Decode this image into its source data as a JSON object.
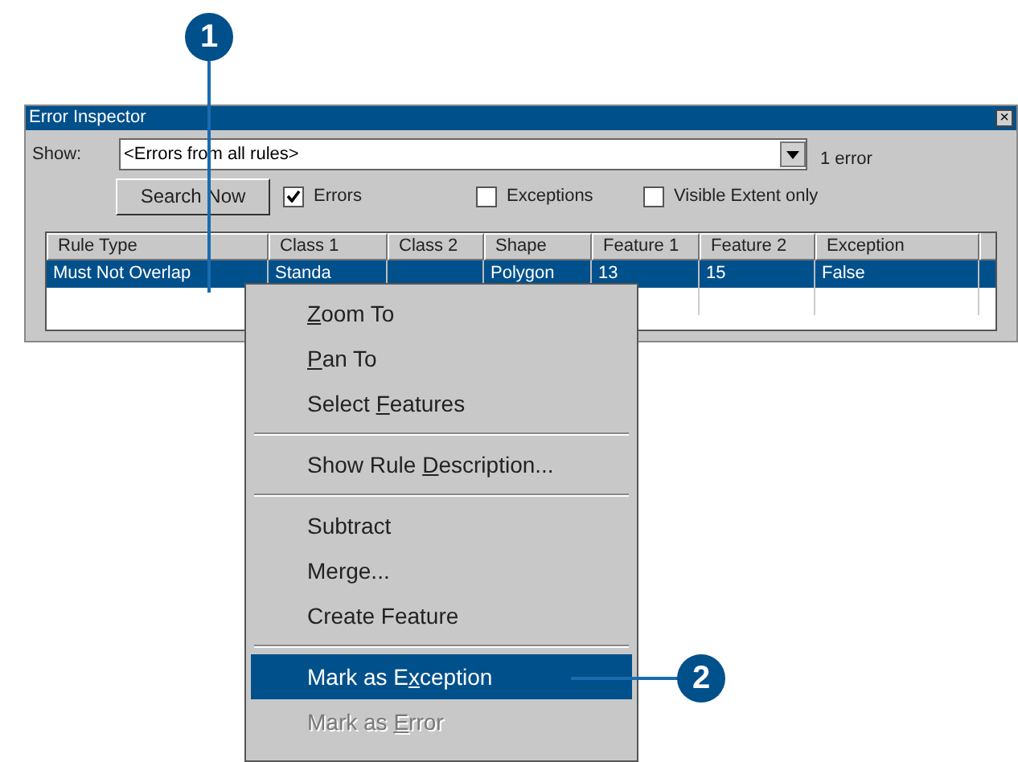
{
  "callouts": [
    {
      "number": "1"
    },
    {
      "number": "2"
    }
  ],
  "window": {
    "title": "Error Inspector",
    "close": "×"
  },
  "show": {
    "label": "Show:",
    "value": "<Errors from all rules>",
    "count": "1 error"
  },
  "search_button": "Search Now",
  "checkboxes": [
    {
      "label": "Errors",
      "checked": true
    },
    {
      "label": "Exceptions",
      "checked": false
    },
    {
      "label": "Visible Extent only",
      "checked": false
    }
  ],
  "table": {
    "columns": [
      "Rule Type",
      "Class 1",
      "Class 2",
      "Shape",
      "Feature 1",
      "Feature 2",
      "Exception"
    ],
    "rows": [
      {
        "selected": true,
        "cells": [
          "Must Not Overlap",
          "Standa",
          "",
          "Polygon",
          "13",
          "15",
          "False"
        ]
      }
    ]
  },
  "context_menu": {
    "groups": [
      [
        {
          "access_key": "Z",
          "after": "oom To",
          "selected": false,
          "disabled": false
        },
        {
          "access_key": "P",
          "after": "an To",
          "selected": false,
          "disabled": false
        },
        {
          "before": "Select ",
          "access_key": "F",
          "after": "eatures",
          "selected": false,
          "disabled": false
        }
      ],
      [
        {
          "before": "Show Rule ",
          "access_key": "D",
          "after": "escription...",
          "selected": false,
          "disabled": false
        }
      ],
      [
        {
          "label": "Subtract",
          "selected": false,
          "disabled": false
        },
        {
          "label": "Merge...",
          "selected": false,
          "disabled": false
        },
        {
          "label": "Create Feature",
          "selected": false,
          "disabled": false
        }
      ],
      [
        {
          "before": "Mark as E",
          "access_key": "x",
          "after": "ception",
          "selected": true,
          "disabled": false
        },
        {
          "before": "Mark as ",
          "access_key": "E",
          "after": "rror",
          "selected": false,
          "disabled": true
        }
      ]
    ]
  }
}
